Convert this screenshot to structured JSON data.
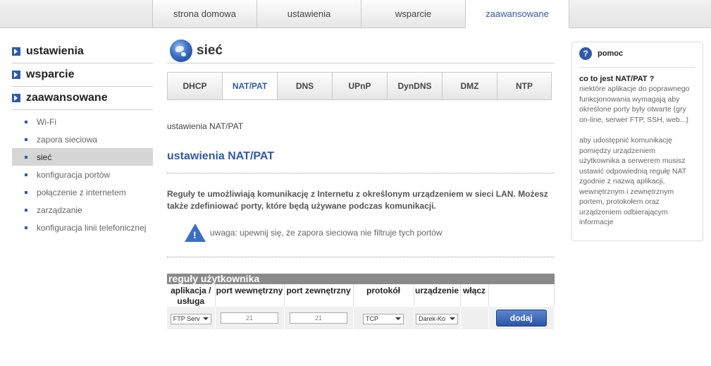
{
  "top_tabs": [
    "strona domowa",
    "ustawienia",
    "wsparcie",
    "zaawansowane"
  ],
  "sidebar": {
    "sections": [
      "ustawienia",
      "wsparcie",
      "zaawansowane"
    ],
    "items": [
      "Wi-Fi",
      "zapora sieciowa",
      "sieć",
      "konfiguracja portów",
      "połączenie z internetem",
      "zarządzanie",
      "konfiguracja linii telefonicznej"
    ]
  },
  "page": {
    "title": "sieć",
    "sub_tabs": [
      "DHCP",
      "NAT/PAT",
      "DNS",
      "UPnP",
      "DynDNS",
      "DMZ",
      "NTP"
    ],
    "breadcrumb": "ustawienia NAT/PAT",
    "section_title": "ustawienia NAT/PAT",
    "description": "Reguły te umożliwiają komunikację z Internetu z określonym urządzeniem w sieci LAN. Możesz także zdefiniować porty, które będą używane podczas komunikacji.",
    "warning": "uwaga: upewnij się, że zapora sieciowa nie filtruje tych portów"
  },
  "rules": {
    "title": "reguły użytkownika",
    "headers": {
      "app": "aplikacja / usługa",
      "port_int": "port wewnętrzny",
      "port_ext": "port zewnętrzny",
      "protocol": "protokół",
      "device": "urządzenie",
      "enable": "włącz"
    },
    "row": {
      "app": "FTP Serv",
      "port_int": "21",
      "port_ext": "21",
      "protocol": "TCP",
      "device": "Darek-Ko"
    },
    "add_label": "dodaj"
  },
  "help": {
    "title": "pomoc",
    "question": "co to jest NAT/PAT ?",
    "p1": "niektóre aplikacje do poprawnego funkcjonowania wymagają aby określone porty były otwarte (gry on-line, serwer FTP, SSH, web...)",
    "p2": "aby udostępnić komunikację pomiędzy urządzeniem użytkownika a serwerem musisz ustawić odpowiednią regułę NAT zgodnie z nazwą aplikacji, wewnętrznym i zewnętrznym portem, protokołem oraz urządzeniem odbierającym informacje"
  }
}
